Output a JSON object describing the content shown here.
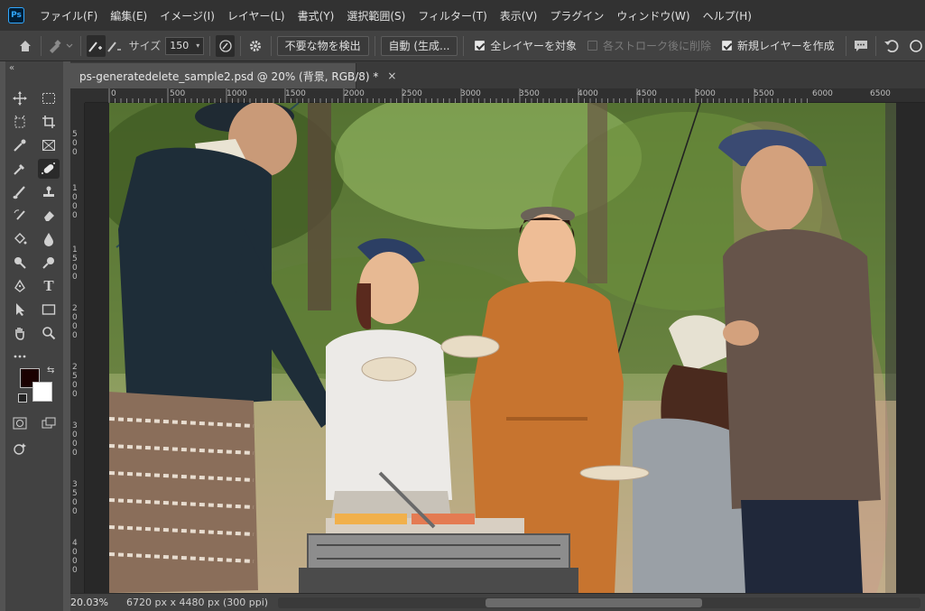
{
  "app": {
    "logo_text": "Ps"
  },
  "menu": [
    "ファイル(F)",
    "編集(E)",
    "イメージ(I)",
    "レイヤー(L)",
    "書式(Y)",
    "選択範囲(S)",
    "フィルター(T)",
    "表示(V)",
    "プラグイン",
    "ウィンドウ(W)",
    "ヘルプ(H)"
  ],
  "options": {
    "size_label": "サイズ",
    "size_value": "150",
    "detect_button": "不要な物を検出",
    "mode_dropdown": "自動 (生成...",
    "sample_all_layers": {
      "label": "全レイヤーを対象",
      "checked": true
    },
    "delete_after_stroke": {
      "label": "各ストローク後に削除",
      "checked": false
    },
    "new_layer": {
      "label": "新規レイヤーを作成",
      "checked": true
    }
  },
  "document": {
    "tab_title": "ps-generatedelete_sample2.psd @ 20% (背景, RGB/8) *",
    "close_symbol": "×"
  },
  "ruler": {
    "h_labels": [
      "0",
      "500",
      "1000",
      "1500",
      "2000",
      "2500",
      "3000",
      "3500",
      "4000",
      "4500",
      "5000",
      "5500",
      "6000",
      "6500"
    ],
    "v_labels": [
      "500",
      "1000",
      "1500",
      "2000",
      "2500",
      "3000",
      "3500",
      "4000"
    ]
  },
  "status": {
    "zoom": "20.03%",
    "doc_info": "6720 px x 4480 px (300 ppi)",
    "arrow": "›"
  },
  "colors": {
    "foreground": "#1a0000",
    "background": "#ffffff",
    "accent": "#31a8ff"
  }
}
